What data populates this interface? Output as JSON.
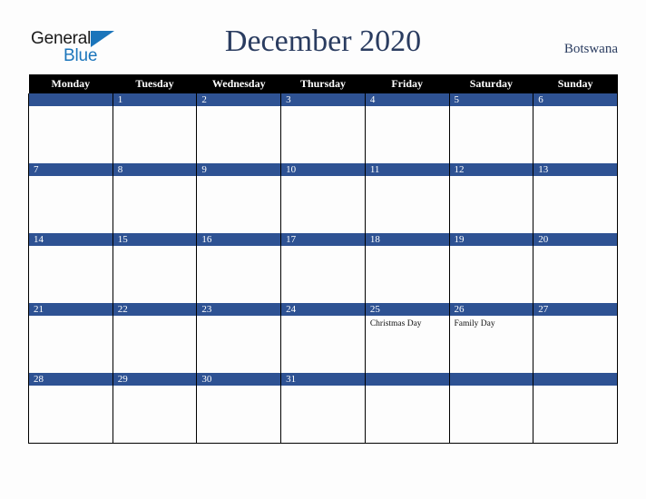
{
  "brand": {
    "name_part1": "General",
    "name_part2": "Blue",
    "triangle_color": "#1b75bb",
    "text_color": "#1a1a1a"
  },
  "header": {
    "title": "December 2020",
    "region": "Botswana",
    "title_color": "#2a3c60"
  },
  "theme": {
    "header_row_bg": "#000000",
    "header_row_text": "#ffffff",
    "daybar_bg": "#2e5293",
    "daybar_text": "#ffffff",
    "cell_bg": "#fdfdfd",
    "grid_line": "#000000",
    "page_bg": "#fdfdfd"
  },
  "weekdays": [
    "Monday",
    "Tuesday",
    "Wednesday",
    "Thursday",
    "Friday",
    "Saturday",
    "Sunday"
  ],
  "weeks": [
    [
      {
        "day": "",
        "events": []
      },
      {
        "day": "1",
        "events": []
      },
      {
        "day": "2",
        "events": []
      },
      {
        "day": "3",
        "events": []
      },
      {
        "day": "4",
        "events": []
      },
      {
        "day": "5",
        "events": []
      },
      {
        "day": "6",
        "events": []
      }
    ],
    [
      {
        "day": "7",
        "events": []
      },
      {
        "day": "8",
        "events": []
      },
      {
        "day": "9",
        "events": []
      },
      {
        "day": "10",
        "events": []
      },
      {
        "day": "11",
        "events": []
      },
      {
        "day": "12",
        "events": []
      },
      {
        "day": "13",
        "events": []
      }
    ],
    [
      {
        "day": "14",
        "events": []
      },
      {
        "day": "15",
        "events": []
      },
      {
        "day": "16",
        "events": []
      },
      {
        "day": "17",
        "events": []
      },
      {
        "day": "18",
        "events": []
      },
      {
        "day": "19",
        "events": []
      },
      {
        "day": "20",
        "events": []
      }
    ],
    [
      {
        "day": "21",
        "events": []
      },
      {
        "day": "22",
        "events": []
      },
      {
        "day": "23",
        "events": []
      },
      {
        "day": "24",
        "events": []
      },
      {
        "day": "25",
        "events": [
          "Christmas Day"
        ]
      },
      {
        "day": "26",
        "events": [
          "Family Day"
        ]
      },
      {
        "day": "27",
        "events": []
      }
    ],
    [
      {
        "day": "28",
        "events": []
      },
      {
        "day": "29",
        "events": []
      },
      {
        "day": "30",
        "events": []
      },
      {
        "day": "31",
        "events": []
      },
      {
        "day": "",
        "events": []
      },
      {
        "day": "",
        "events": []
      },
      {
        "day": "",
        "events": []
      }
    ]
  ]
}
